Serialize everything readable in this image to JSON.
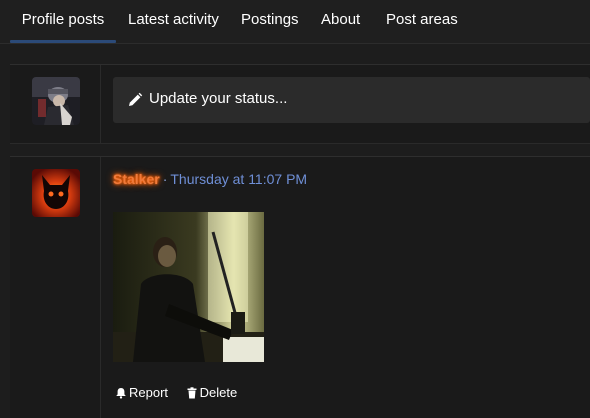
{
  "tabs": [
    {
      "label": "Profile posts",
      "active": true
    },
    {
      "label": "Latest activity"
    },
    {
      "label": "Postings"
    },
    {
      "label": "About"
    },
    {
      "label": "Post areas"
    }
  ],
  "status": {
    "prompt": "Update your status..."
  },
  "post": {
    "username": "Stalker",
    "separator": "·",
    "time": "Thursday at 11:07 PM",
    "actions": {
      "report": "Report",
      "delete": "Delete"
    }
  },
  "colors": {
    "background": "#1d1d1d",
    "active_tab_underline": "#2b4a78",
    "username": "#f07a3a",
    "time_link": "#6f8fd6"
  },
  "icons": [
    "pencil-icon",
    "bell-icon",
    "trash-icon"
  ]
}
